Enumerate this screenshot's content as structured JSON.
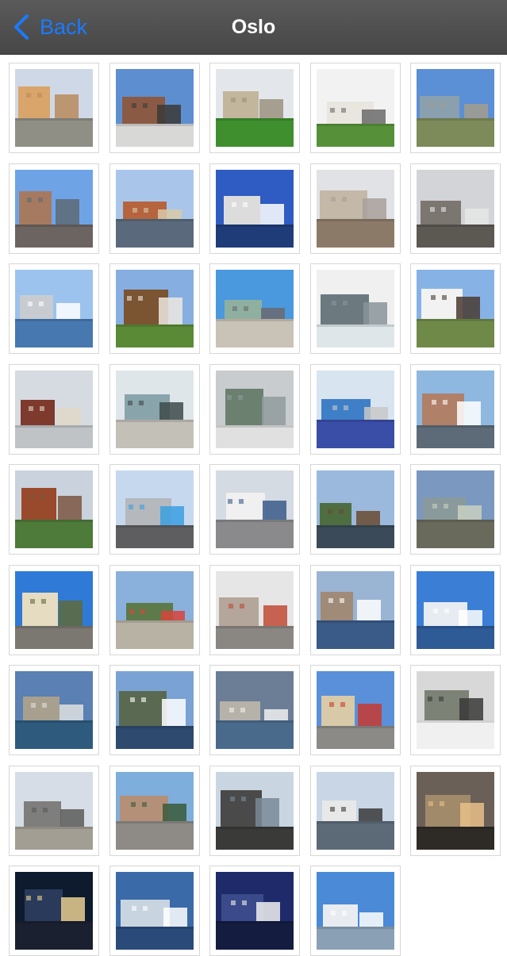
{
  "navbar": {
    "back_label": "Back",
    "title": "Oslo"
  },
  "colors": {
    "navbar": "#4e4e4e",
    "accent": "#1a7bff",
    "title_text": "#ffffff"
  },
  "gallery": {
    "photos": [
      {
        "name": "building-facade",
        "sky": "#cfd8e6",
        "mid": "#d9a56b",
        "ground": "#8f8f86",
        "accent": "#b98a5c"
      },
      {
        "name": "city-hall-statue",
        "sky": "#5d8fd0",
        "mid": "#8b5a44",
        "ground": "#d8d8d6",
        "accent": "#3a3a36"
      },
      {
        "name": "domed-building-lawn",
        "sky": "#e3e7ec",
        "mid": "#c2b79c",
        "ground": "#3f8f2f",
        "accent": "#9b9280"
      },
      {
        "name": "white-house-garden",
        "sky": "#f2f2f2",
        "mid": "#e9e6e0",
        "ground": "#56913a",
        "accent": "#6b6b6b"
      },
      {
        "name": "fortress-field",
        "sky": "#5b8fd6",
        "mid": "#8aa0ae",
        "ground": "#7d8a5a",
        "accent": "#a59e8e"
      },
      {
        "name": "high-rise-street",
        "sky": "#6ea4e6",
        "mid": "#a67a60",
        "ground": "#6b6460",
        "accent": "#5e6a74"
      },
      {
        "name": "castle-waterfront",
        "sky": "#a9c6ea",
        "mid": "#b5643e",
        "ground": "#5a6a7c",
        "accent": "#d9c9a8"
      },
      {
        "name": "opera-house-water",
        "sky": "#2f5cc2",
        "mid": "#dcdcdc",
        "ground": "#1f3c78",
        "accent": "#ffffff"
      },
      {
        "name": "city-panorama",
        "sky": "#e0e2e6",
        "mid": "#c4b8a8",
        "ground": "#8c7a68",
        "accent": "#a9a09a"
      },
      {
        "name": "city-aerial-stadium",
        "sky": "#d2d4d8",
        "mid": "#7c7670",
        "ground": "#5c5852",
        "accent": "#e6e6e6"
      },
      {
        "name": "harbor-boats",
        "sky": "#9cc3ee",
        "mid": "#c8ccd0",
        "ground": "#4778b0",
        "accent": "#ffffff"
      },
      {
        "name": "wooden-farmhouse",
        "sky": "#86aee0",
        "mid": "#7b5432",
        "ground": "#5a8a36",
        "accent": "#ece8e0"
      },
      {
        "name": "sculpture-plaza",
        "sky": "#4a98de",
        "mid": "#8fb0a0",
        "ground": "#c9c2b6",
        "accent": "#6a6a70"
      },
      {
        "name": "ski-jump-view",
        "sky": "#f0f0f0",
        "mid": "#6c7a80",
        "ground": "#dfe6ea",
        "accent": "#8a949a"
      },
      {
        "name": "white-church",
        "sky": "#86b2e6",
        "mid": "#f2f2f2",
        "ground": "#6f8a48",
        "accent": "#4a3a30"
      },
      {
        "name": "city-hall-brick",
        "sky": "#d6dbe2",
        "mid": "#7e3a2c",
        "ground": "#bfc3c6",
        "accent": "#e0d8c8"
      },
      {
        "name": "fjord-statue",
        "sky": "#dfe6ea",
        "mid": "#8aa4ac",
        "ground": "#c3c0b8",
        "accent": "#3e4a4a"
      },
      {
        "name": "grey-waterfront",
        "sky": "#c8cccf",
        "mid": "#6c8070",
        "ground": "#e0e0e0",
        "accent": "#909a9c"
      },
      {
        "name": "modern-office-street",
        "sky": "#d8e4f0",
        "mid": "#3f7fc8",
        "ground": "#3a4ea8",
        "accent": "#c8c8c8"
      },
      {
        "name": "marina-city",
        "sky": "#8fb8e0",
        "mid": "#b08068",
        "ground": "#5d6a78",
        "accent": "#ffffff"
      },
      {
        "name": "city-hall-towers",
        "sky": "#c9d2dd",
        "mid": "#9a4a2c",
        "ground": "#4e7a3a",
        "accent": "#7c5642"
      },
      {
        "name": "tram-street",
        "sky": "#c6d8ee",
        "mid": "#b5b8bc",
        "ground": "#5e5e60",
        "accent": "#3aa0e0"
      },
      {
        "name": "cruise-ship-pier",
        "sky": "#d4dbe3",
        "mid": "#f0f0f0",
        "ground": "#8a8a8c",
        "accent": "#3a5a8a"
      },
      {
        "name": "tall-ship-harbor",
        "sky": "#9bb9dc",
        "mid": "#4e6e42",
        "ground": "#3a4a58",
        "accent": "#6a4a30"
      },
      {
        "name": "glass-tower",
        "sky": "#7a98c0",
        "mid": "#8a9a9c",
        "ground": "#6a6a5c",
        "accent": "#c8d0c0"
      },
      {
        "name": "royal-palace",
        "sky": "#2e7ad6",
        "mid": "#e6dcc2",
        "ground": "#7a7870",
        "accent": "#5f6a3a"
      },
      {
        "name": "park-crowd",
        "sky": "#8ab0dc",
        "mid": "#5c7a4a",
        "ground": "#b8b2a4",
        "accent": "#d8443a"
      },
      {
        "name": "shopping-street",
        "sky": "#e6e6e6",
        "mid": "#b4a69a",
        "ground": "#8a8682",
        "accent": "#c04a34"
      },
      {
        "name": "harbor-ferry",
        "sky": "#9ab4d4",
        "mid": "#a08a78",
        "ground": "#3a5a88",
        "accent": "#ffffff"
      },
      {
        "name": "harbor-clouds",
        "sky": "#3a7ed6",
        "mid": "#e6ecf2",
        "ground": "#2e5a96",
        "accent": "#ffffff"
      },
      {
        "name": "aerial-peninsula",
        "sky": "#5a80b4",
        "mid": "#a8a08e",
        "ground": "#2e5a7e",
        "accent": "#e0e0e0"
      },
      {
        "name": "cruise-ship-aerial",
        "sky": "#7aa2d4",
        "mid": "#5a6a52",
        "ground": "#2e4a6e",
        "accent": "#ffffff"
      },
      {
        "name": "harbor-skyline",
        "sky": "#6c7e96",
        "mid": "#b6b2aa",
        "ground": "#4a6a8c",
        "accent": "#f0f0f0"
      },
      {
        "name": "palace-crowd",
        "sky": "#5a90da",
        "mid": "#d8caa8",
        "ground": "#8c8a86",
        "accent": "#c83a30"
      },
      {
        "name": "winter-church",
        "sky": "#d8d8d8",
        "mid": "#7c8276",
        "ground": "#f0f0f0",
        "accent": "#3a3a38"
      },
      {
        "name": "monolith-sculpture",
        "sky": "#d6dde6",
        "mid": "#7e7e7c",
        "ground": "#a29e94",
        "accent": "#5a5a58"
      },
      {
        "name": "plaza-towers",
        "sky": "#7eaedc",
        "mid": "#b49078",
        "ground": "#8e8a86",
        "accent": "#3a5a3a"
      },
      {
        "name": "tall-ship-masts",
        "sky": "#c9d6e2",
        "mid": "#4a4a4a",
        "ground": "#3a3a38",
        "accent": "#7a8a98"
      },
      {
        "name": "opera-roof-water",
        "sky": "#c8d6e6",
        "mid": "#e8e8e8",
        "ground": "#5c6a78",
        "accent": "#3a3a38"
      },
      {
        "name": "modern-arch-museum",
        "sky": "#6a6058",
        "mid": "#a08a6a",
        "ground": "#2e2a26",
        "accent": "#e8c088"
      },
      {
        "name": "night-city",
        "sky": "#0e1a2e",
        "mid": "#2a3a5a",
        "ground": "#1a2030",
        "accent": "#e8d090"
      },
      {
        "name": "bridge-harbor",
        "sky": "#3a6aa8",
        "mid": "#c8d4e0",
        "ground": "#2a4a7a",
        "accent": "#ffffff"
      },
      {
        "name": "moonlit-sky",
        "sky": "#1e2a6a",
        "mid": "#3a4a8a",
        "ground": "#141c40",
        "accent": "#f0f0f0"
      },
      {
        "name": "opera-rooftop",
        "sky": "#4a8ad6",
        "mid": "#e8ecf0",
        "ground": "#8aa0b4",
        "accent": "#ffffff"
      }
    ]
  }
}
